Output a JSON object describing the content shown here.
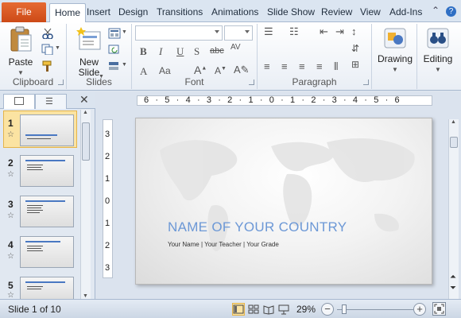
{
  "tabs": {
    "file": "File",
    "items": [
      "Home",
      "Insert",
      "Design",
      "Transitions",
      "Animations",
      "Slide Show",
      "Review",
      "View",
      "Add-Ins"
    ]
  },
  "ribbon": {
    "clipboard": {
      "paste_label": "Paste",
      "group_label": "Clipboard"
    },
    "slides": {
      "new_slide_label_1": "New",
      "new_slide_label_2": "Slide",
      "group_label": "Slides"
    },
    "font": {
      "group_label": "Font"
    },
    "paragraph": {
      "group_label": "Paragraph"
    },
    "drawing": {
      "label": "Drawing"
    },
    "editing": {
      "label": "Editing"
    }
  },
  "slides_pane": {
    "thumbnails": [
      {
        "number": "1",
        "selected": true
      },
      {
        "number": "2",
        "selected": false
      },
      {
        "number": "3",
        "selected": false
      },
      {
        "number": "4",
        "selected": false
      },
      {
        "number": "5",
        "selected": false
      }
    ]
  },
  "ruler": {
    "horizontal": "6 · 5 · 4 · 3 · 2 · 1 · 0 · 1 · 2 · 3 · 4 · 5 · 6",
    "vertical": [
      "3",
      "2",
      "1",
      "0",
      "1",
      "2",
      "3"
    ]
  },
  "slide": {
    "title": "NAME OF YOUR COUNTRY",
    "subtitle": "Your Name | Your Teacher | Your Grade"
  },
  "status": {
    "slide_info": "Slide 1 of 10",
    "zoom": "29%"
  },
  "colors": {
    "file_tab": "#d65a25",
    "title_text": "#6c98d6",
    "selection": "#fbe3a2"
  }
}
